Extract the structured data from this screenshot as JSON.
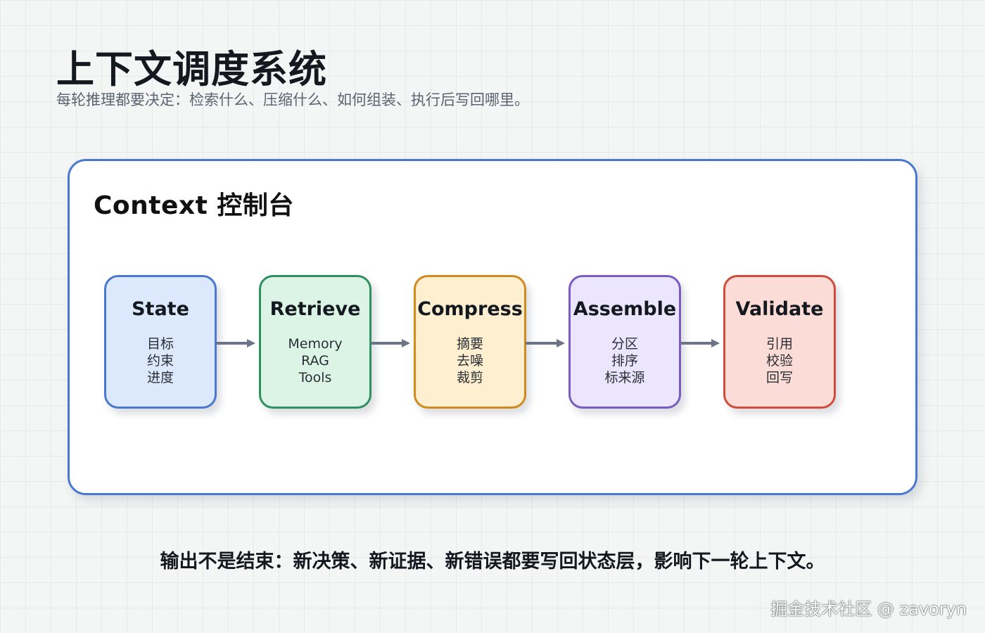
{
  "title": "上下文调度系统",
  "subtitle": "每轮推理都要决定：检索什么、压缩什么、如何组装、执行后写回哪里。",
  "panel": {
    "title": "Context 控制台",
    "stages": [
      {
        "name": "State",
        "items": [
          "目标",
          "约束",
          "进度"
        ],
        "fill": "#dce9fd",
        "border": "#4a78d0"
      },
      {
        "name": "Retrieve",
        "items": [
          "Memory",
          "RAG",
          "Tools"
        ],
        "fill": "#dcf4e6",
        "border": "#2f9160"
      },
      {
        "name": "Compress",
        "items": [
          "摘要",
          "去噪",
          "裁剪"
        ],
        "fill": "#fdefcf",
        "border": "#d28a1e"
      },
      {
        "name": "Assemble",
        "items": [
          "分区",
          "排序",
          "标来源"
        ],
        "fill": "#ebe5fd",
        "border": "#7a5cc0"
      },
      {
        "name": "Validate",
        "items": [
          "引用",
          "校验",
          "回写"
        ],
        "fill": "#fcdcd6",
        "border": "#d24c3c"
      }
    ],
    "arrow_color": "#6b7587"
  },
  "footer_note": "输出不是结束：新决策、新证据、新错误都要写回状态层，影响下一轮上下文。",
  "watermark": "掘金技术社区 @ zavoryn"
}
